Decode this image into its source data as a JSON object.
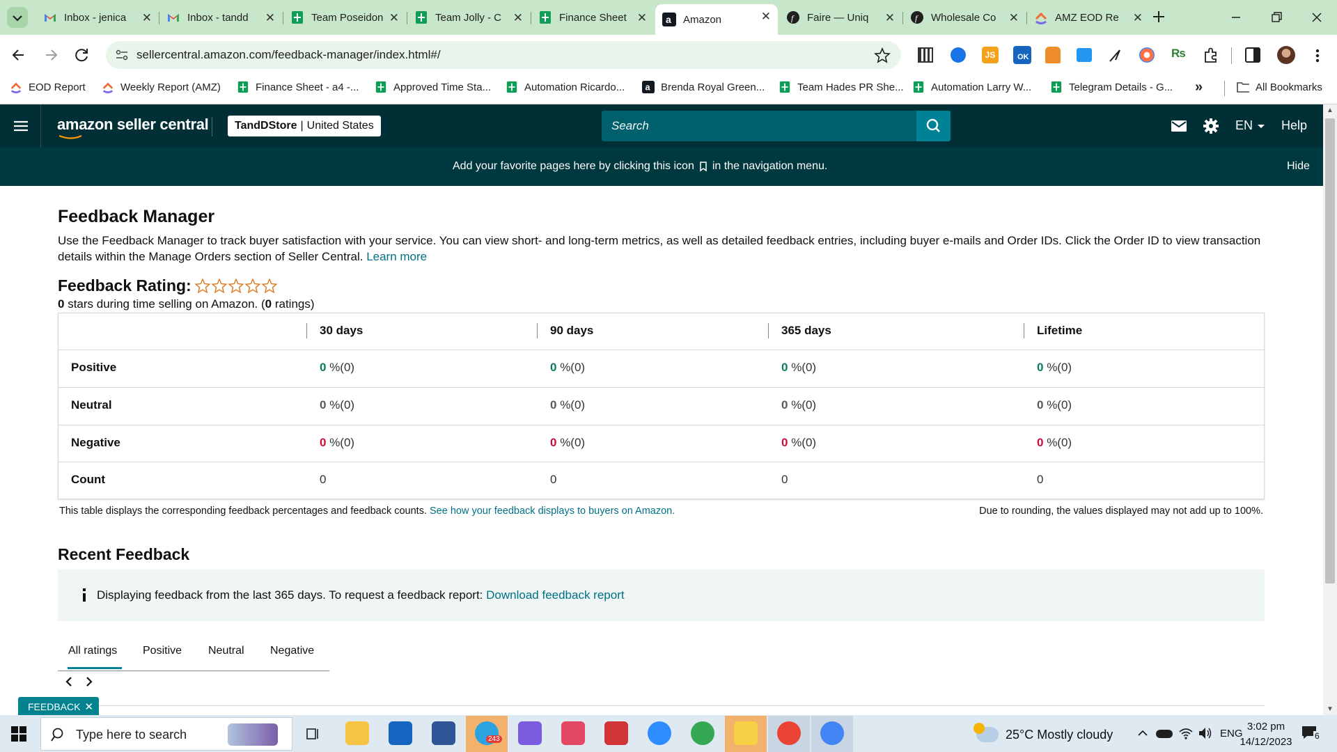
{
  "browser": {
    "tabs": [
      {
        "title": "Inbox - jenica",
        "icon": "gmail-icon"
      },
      {
        "title": "Inbox - tandd",
        "icon": "gmail-icon"
      },
      {
        "title": "Team Poseidon",
        "icon": "sheets-icon"
      },
      {
        "title": "Team Jolly - C",
        "icon": "sheets-icon"
      },
      {
        "title": "Finance Sheet",
        "icon": "sheets-icon"
      },
      {
        "title": "Amazon",
        "icon": "amazon-icon",
        "active": true
      },
      {
        "title": "Faire — Uniq",
        "icon": "faire-icon"
      },
      {
        "title": "Wholesale Co",
        "icon": "faire-icon"
      },
      {
        "title": "AMZ EOD Re",
        "icon": "clickup-icon"
      }
    ],
    "url": "sellercentral.amazon.com/feedback-manager/index.html#/",
    "bookmarks": [
      {
        "label": "EOD Report",
        "icon": "clickup-icon"
      },
      {
        "label": "Weekly Report (AMZ)",
        "icon": "clickup-icon"
      },
      {
        "label": "Finance Sheet - a4 -...",
        "icon": "sheets-icon"
      },
      {
        "label": "Approved Time Sta...",
        "icon": "sheets-icon"
      },
      {
        "label": "Automation Ricardo...",
        "icon": "sheets-icon"
      },
      {
        "label": "Brenda Royal Green...",
        "icon": "amazon-icon"
      },
      {
        "label": "Team Hades PR She...",
        "icon": "sheets-icon"
      },
      {
        "label": "Automation Larry W...",
        "icon": "sheets-icon"
      },
      {
        "label": "Telegram Details - G...",
        "icon": "sheets-icon"
      }
    ],
    "all_bookmarks": "All Bookmarks",
    "extension_badge": "OK"
  },
  "seller_central": {
    "logo_text": "amazon seller central",
    "store_name": "TandDStore",
    "store_region": "United States",
    "search_placeholder": "Search",
    "language": "EN",
    "help": "Help",
    "fav_banner": "Add your favorite pages here by clicking this icon",
    "fav_banner_suffix": "in the navigation menu.",
    "hide": "Hide"
  },
  "page": {
    "title": "Feedback Manager",
    "description": "Use the Feedback Manager to track buyer satisfaction with your service. You can view short- and long-term metrics, as well as detailed feedback entries, including buyer e-mails and Order IDs. Click the Order ID to view transaction details within the Manage Orders section of Seller Central.",
    "learn_more": "Learn more",
    "rating_label": "Feedback Rating:",
    "rating_stars": 0,
    "rating_max": 5,
    "rating_summary_count": "0",
    "rating_summary_text": " stars during time selling on Amazon. (",
    "rating_summary_ratings": "0",
    "rating_summary_end": " ratings)",
    "table": {
      "columns": [
        "30 days",
        "90 days",
        "365 days",
        "Lifetime"
      ],
      "rows": [
        {
          "label": "Positive",
          "cells": [
            {
              "pct": "0",
              "suffix": " %(0)"
            },
            {
              "pct": "0",
              "suffix": " %(0)"
            },
            {
              "pct": "0",
              "suffix": " %(0)"
            },
            {
              "pct": "0",
              "suffix": " %(0)"
            }
          ]
        },
        {
          "label": "Neutral",
          "cells": [
            {
              "pct": "0",
              "suffix": " %(0)"
            },
            {
              "pct": "0",
              "suffix": " %(0)"
            },
            {
              "pct": "0",
              "suffix": " %(0)"
            },
            {
              "pct": "0",
              "suffix": " %(0)"
            }
          ]
        },
        {
          "label": "Negative",
          "cells": [
            {
              "pct": "0",
              "suffix": " %(0)"
            },
            {
              "pct": "0",
              "suffix": " %(0)"
            },
            {
              "pct": "0",
              "suffix": " %(0)"
            },
            {
              "pct": "0",
              "suffix": " %(0)"
            }
          ]
        },
        {
          "label": "Count",
          "cells": [
            {
              "pct": "0",
              "suffix": ""
            },
            {
              "pct": "0",
              "suffix": ""
            },
            {
              "pct": "0",
              "suffix": ""
            },
            {
              "pct": "0",
              "suffix": ""
            }
          ]
        }
      ]
    },
    "table_note": "This table displays the corresponding feedback percentages and feedback counts.",
    "table_note_link": "See how your feedback displays to buyers on Amazon.",
    "rounding_note": "Due to rounding, the values displayed may not add up to 100%.",
    "recent_title": "Recent Feedback",
    "info_text": "Displaying feedback from the last 365 days. To request a feedback report:",
    "info_link": "Download feedback report",
    "filter_tabs": [
      "All ratings",
      "Positive",
      "Neutral",
      "Negative"
    ],
    "feedback_button": "FEEDBACK"
  },
  "taskbar": {
    "search_placeholder": "Type here to search",
    "telegram_badge": "243",
    "weather": "25°C  Mostly cloudy",
    "language": "ENG",
    "time": "3:02 pm",
    "date": "14/12/2023",
    "notification_count": "6"
  },
  "colors": {
    "tab_bar": "#c8e6c9",
    "nav_dark": "#002f36",
    "fav_bar": "#00383f",
    "link": "#007185",
    "positive": "#067d62",
    "negative": "#cc0c39",
    "search_button": "#008296"
  }
}
